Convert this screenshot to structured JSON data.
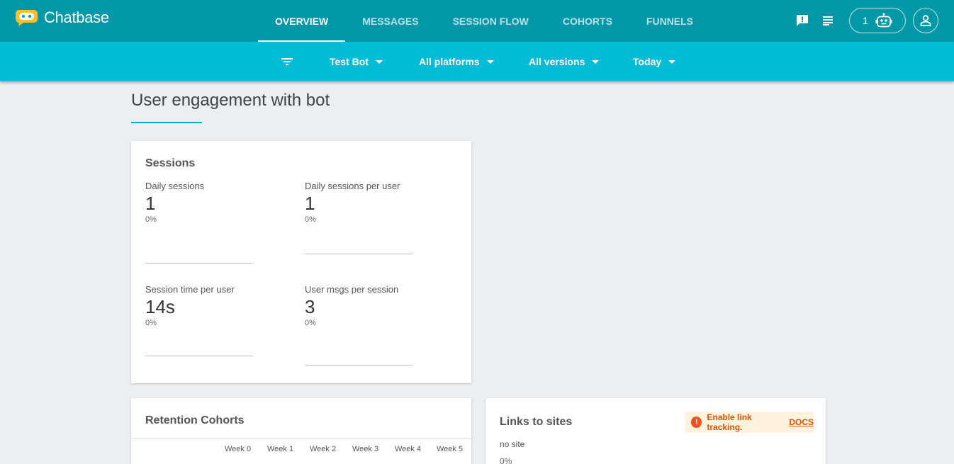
{
  "brand": {
    "name": "Chatbase"
  },
  "nav": {
    "tabs": [
      {
        "label": "OVERVIEW",
        "active": true
      },
      {
        "label": "MESSAGES",
        "active": false
      },
      {
        "label": "SESSION FLOW",
        "active": false
      },
      {
        "label": "COHORTS",
        "active": false
      },
      {
        "label": "FUNNELS",
        "active": false
      }
    ]
  },
  "top_actions": {
    "feedback_icon": "feedback-icon",
    "notes_icon": "notes-icon",
    "bot_count": "1",
    "bot_icon": "robot-icon",
    "account_icon": "account-icon"
  },
  "filters": {
    "filter_icon": "filter-icon",
    "bot": "Test Bot",
    "platforms": "All platforms",
    "versions": "All versions",
    "range": "Today"
  },
  "page": {
    "title": "User engagement with bot"
  },
  "sessions_card": {
    "title": "Sessions",
    "metrics": [
      {
        "label": "Daily sessions",
        "value": "1",
        "delta": "0%"
      },
      {
        "label": "Daily sessions per user",
        "value": "1",
        "delta": "0%"
      },
      {
        "label": "Session time per user",
        "value": "14s",
        "delta": "0%"
      },
      {
        "label": "User msgs per session",
        "value": "3",
        "delta": "0%"
      }
    ]
  },
  "retention_card": {
    "title": "Retention Cohorts",
    "weeks": [
      "Week 0",
      "Week 1",
      "Week 2",
      "Week 3",
      "Week 4",
      "Week 5"
    ]
  },
  "links_card": {
    "title": "Links to sites",
    "notice_text": "Enable link tracking.",
    "notice_link": "DOCS",
    "notice_icon": "alert-icon",
    "site_label": "no site",
    "site_delta": "0%"
  },
  "colors": {
    "topbar": "#0097a7",
    "filterbar": "#00bcd4",
    "accent": "#00acc1",
    "warning": "#e65100",
    "background": "#eceff1"
  }
}
